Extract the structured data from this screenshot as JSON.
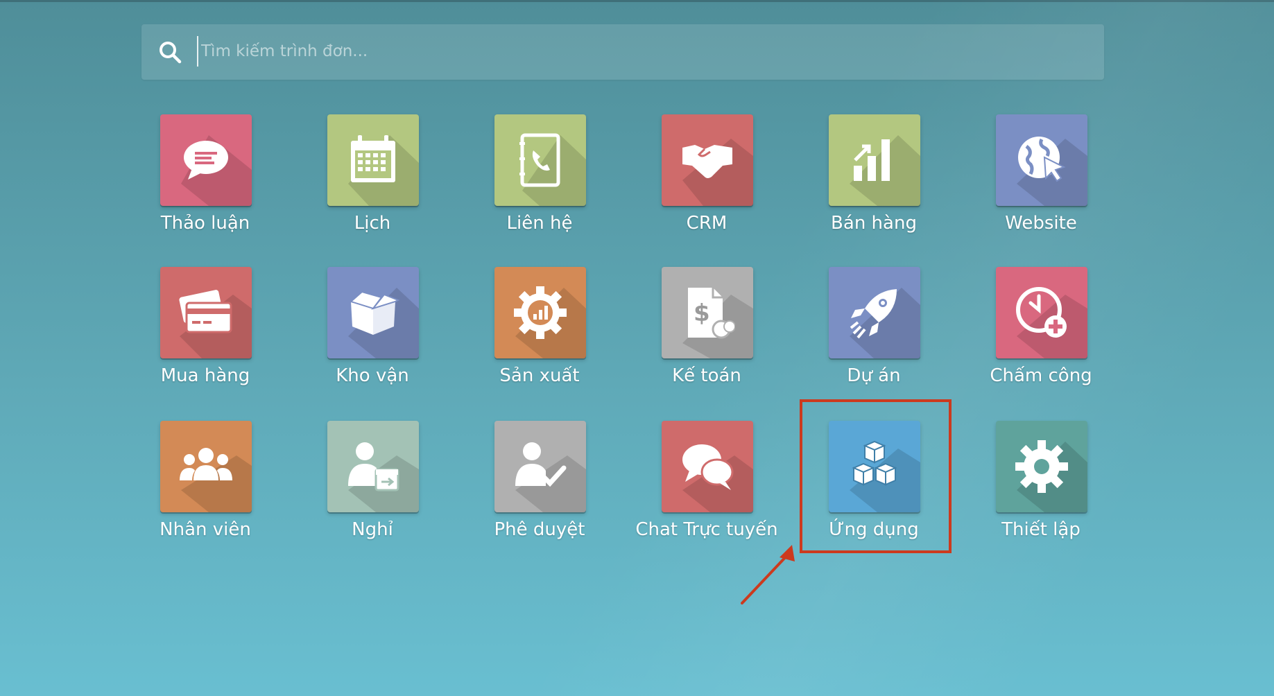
{
  "search": {
    "placeholder": "Tìm kiếm trình đơn..."
  },
  "apps": [
    {
      "label": "Thảo luận",
      "icon": "discuss-icon",
      "color": "#d9687f"
    },
    {
      "label": "Lịch",
      "icon": "calendar-icon",
      "color": "#b3c780"
    },
    {
      "label": "Liên hệ",
      "icon": "contacts-icon",
      "color": "#b3c780"
    },
    {
      "label": "CRM",
      "icon": "crm-handshake-icon",
      "color": "#cf6b6b"
    },
    {
      "label": "Bán hàng",
      "icon": "sales-chart-icon",
      "color": "#b3c780"
    },
    {
      "label": "Website",
      "icon": "website-globe-icon",
      "color": "#7b8fc4"
    },
    {
      "label": "Mua hàng",
      "icon": "purchase-card-icon",
      "color": "#cf6b6b"
    },
    {
      "label": "Kho vận",
      "icon": "inventory-box-icon",
      "color": "#7b8fc4"
    },
    {
      "label": "Sản xuất",
      "icon": "manufacturing-gear-icon",
      "color": "#d38a56"
    },
    {
      "label": "Kế toán",
      "icon": "accounting-invoice-icon",
      "color": "#b0b0b0"
    },
    {
      "label": "Dự án",
      "icon": "project-rocket-icon",
      "color": "#7b8fc4"
    },
    {
      "label": "Chấm công",
      "icon": "timesheet-clock-icon",
      "color": "#d9687f"
    },
    {
      "label": "Nhân viên",
      "icon": "employees-icon",
      "color": "#d38a56"
    },
    {
      "label": "Nghỉ",
      "icon": "leave-icon",
      "color": "#a3c2b5"
    },
    {
      "label": "Phê duyệt",
      "icon": "approval-icon",
      "color": "#b0b0b0"
    },
    {
      "label": "Chat Trực tuyến",
      "icon": "livechat-icon",
      "color": "#cf6b6b"
    },
    {
      "label": "Ứng dụng",
      "icon": "apps-cubes-icon",
      "color": "#5aa7d6"
    },
    {
      "label": "Thiết lập",
      "icon": "settings-gear-icon",
      "color": "#5fa39c"
    }
  ],
  "annotation": {
    "highlight_color": "#cc3a1e",
    "highlighted_app": "Ứng dụng"
  }
}
